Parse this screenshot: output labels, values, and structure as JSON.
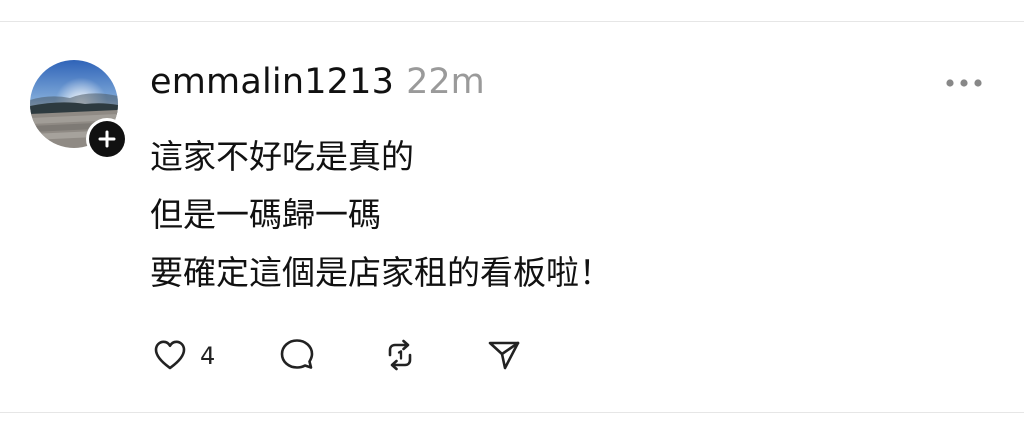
{
  "post": {
    "username": "emmalin1213",
    "timestamp": "22m",
    "lines": [
      "這家不好吃是真的",
      "但是一碼歸一碼",
      "要確定這個是店家租的看板啦！"
    ],
    "actions": {
      "like_count": "4"
    }
  },
  "icons": {
    "avatar": "avatar-image",
    "follow": "plus-icon",
    "more": "more-horizontal-icon",
    "like": "heart-icon",
    "reply": "comment-bubble-icon",
    "repost": "repost-icon",
    "share": "send-icon"
  },
  "colors": {
    "text": "#111111",
    "muted": "#9a9a9a",
    "divider": "#e6e6e6",
    "background": "#ffffff"
  }
}
